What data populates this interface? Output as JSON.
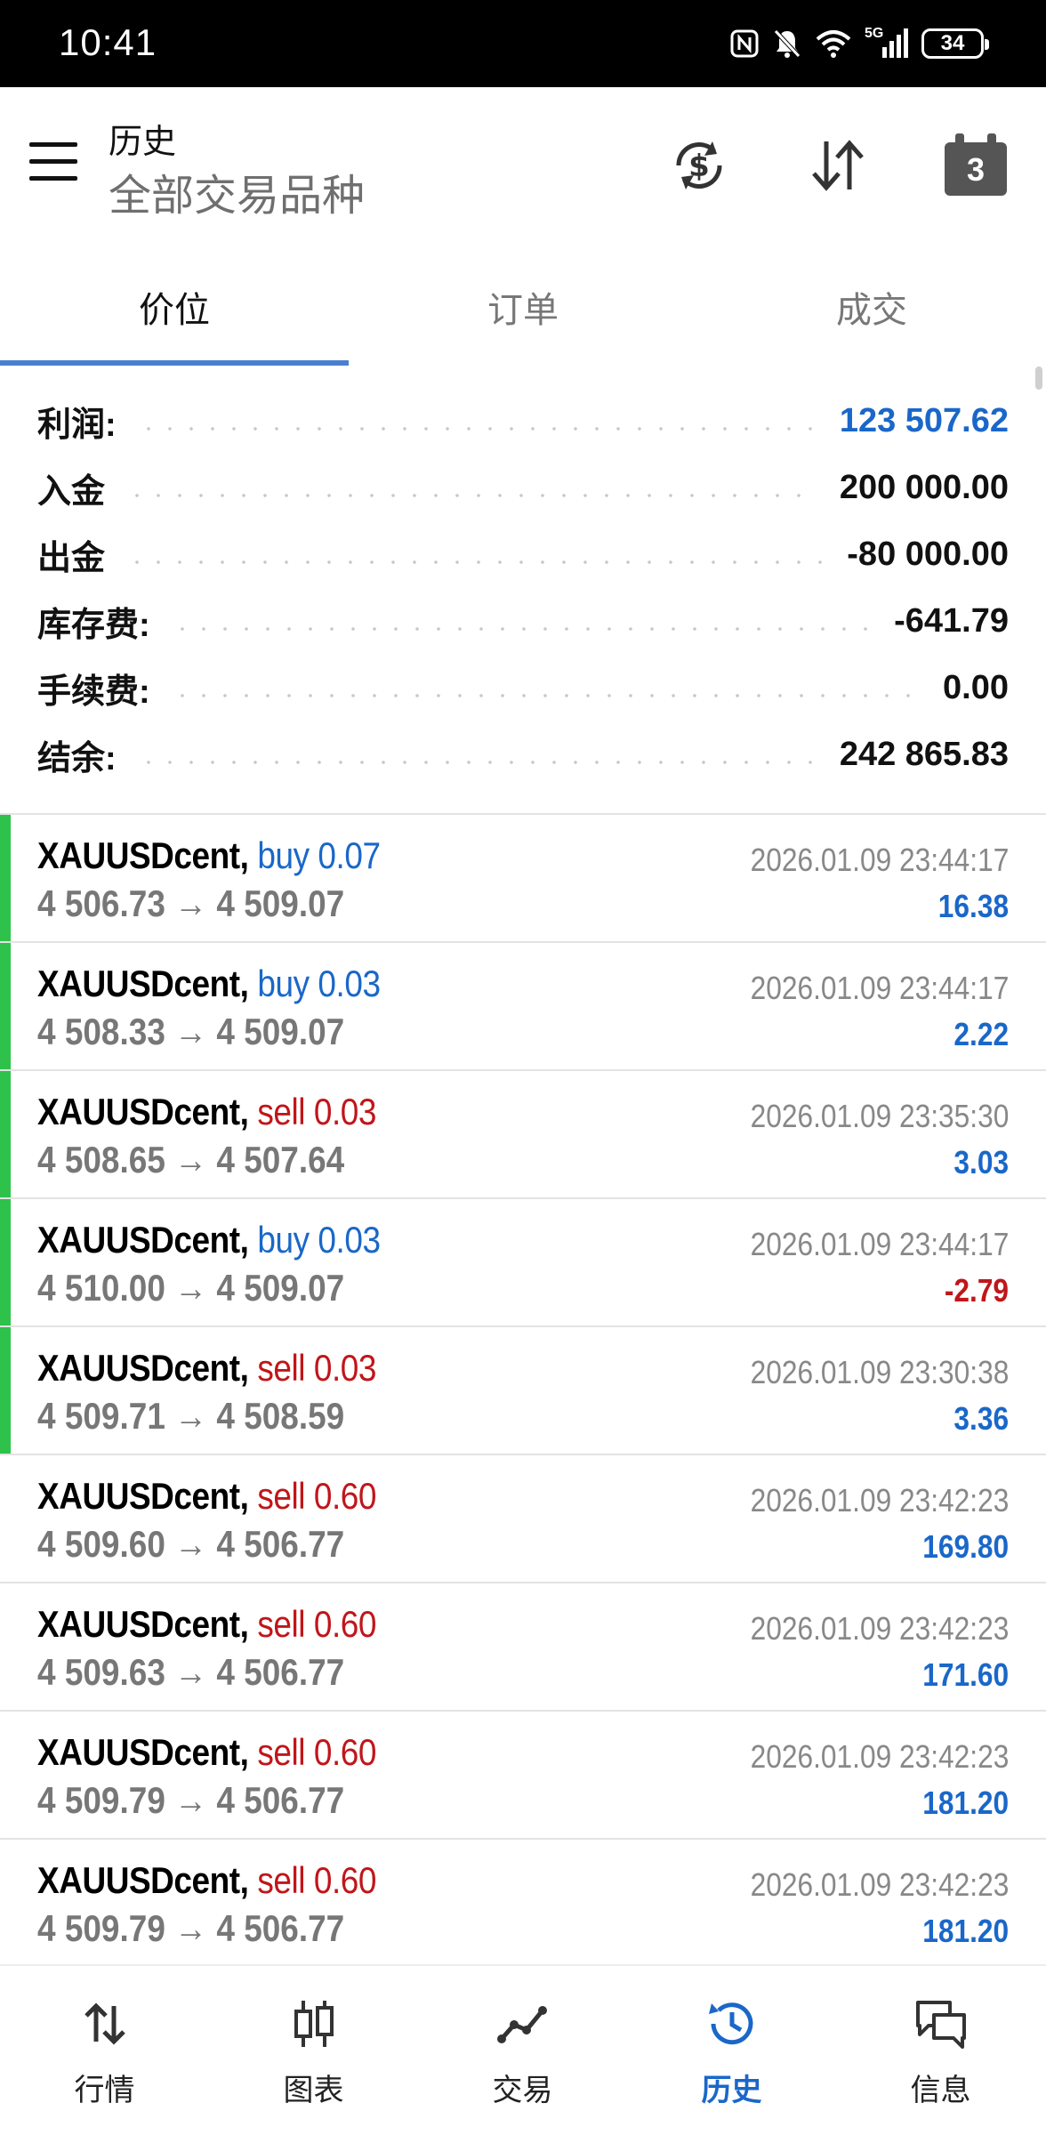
{
  "status_bar": {
    "time": "10:41",
    "network": "5G",
    "battery": "34"
  },
  "header": {
    "title": "历史",
    "subtitle": "全部交易品种"
  },
  "tabs": [
    {
      "label": "价位",
      "active": true
    },
    {
      "label": "订单",
      "active": false
    },
    {
      "label": "成交",
      "active": false
    }
  ],
  "summary": [
    {
      "label": "利润:",
      "value": "123 507.62",
      "highlight": true
    },
    {
      "label": "入金",
      "value": "200 000.00",
      "highlight": false
    },
    {
      "label": "出金",
      "value": "-80 000.00",
      "highlight": false
    },
    {
      "label": "库存费:",
      "value": "-641.79",
      "highlight": false
    },
    {
      "label": "手续费:",
      "value": "0.00",
      "highlight": false
    },
    {
      "label": "结余:",
      "value": "242 865.83",
      "highlight": false
    }
  ],
  "deals": [
    {
      "symbol": "XAUUSDcent,",
      "side": "buy 0.07",
      "type": "buy",
      "prices": "4 506.73 → 4 509.07",
      "time": "2026.01.09 23:44:17",
      "profit": "16.38",
      "profit_sign": "pos",
      "marked": true
    },
    {
      "symbol": "XAUUSDcent,",
      "side": "buy 0.03",
      "type": "buy",
      "prices": "4 508.33 → 4 509.07",
      "time": "2026.01.09 23:44:17",
      "profit": "2.22",
      "profit_sign": "pos",
      "marked": true
    },
    {
      "symbol": "XAUUSDcent,",
      "side": "sell 0.03",
      "type": "sell",
      "prices": "4 508.65 → 4 507.64",
      "time": "2026.01.09 23:35:30",
      "profit": "3.03",
      "profit_sign": "pos",
      "marked": true
    },
    {
      "symbol": "XAUUSDcent,",
      "side": "buy 0.03",
      "type": "buy",
      "prices": "4 510.00 → 4 509.07",
      "time": "2026.01.09 23:44:17",
      "profit": "-2.79",
      "profit_sign": "neg",
      "marked": true
    },
    {
      "symbol": "XAUUSDcent,",
      "side": "sell 0.03",
      "type": "sell",
      "prices": "4 509.71 → 4 508.59",
      "time": "2026.01.09 23:30:38",
      "profit": "3.36",
      "profit_sign": "pos",
      "marked": true
    },
    {
      "symbol": "XAUUSDcent,",
      "side": "sell 0.60",
      "type": "sell",
      "prices": "4 509.60 → 4 506.77",
      "time": "2026.01.09 23:42:23",
      "profit": "169.80",
      "profit_sign": "pos",
      "marked": false
    },
    {
      "symbol": "XAUUSDcent,",
      "side": "sell 0.60",
      "type": "sell",
      "prices": "4 509.63 → 4 506.77",
      "time": "2026.01.09 23:42:23",
      "profit": "171.60",
      "profit_sign": "pos",
      "marked": false
    },
    {
      "symbol": "XAUUSDcent,",
      "side": "sell 0.60",
      "type": "sell",
      "prices": "4 509.79 → 4 506.77",
      "time": "2026.01.09 23:42:23",
      "profit": "181.20",
      "profit_sign": "pos",
      "marked": false
    },
    {
      "symbol": "XAUUSDcent,",
      "side": "sell 0.60",
      "type": "sell",
      "prices": "4 509.79 → 4 506.77",
      "time": "2026.01.09 23:42:23",
      "profit": "181.20",
      "profit_sign": "pos",
      "marked": false
    }
  ],
  "calendar": {
    "day": "3"
  },
  "bottom_nav": [
    {
      "label": "行情",
      "icon": "quotes-icon",
      "active": false
    },
    {
      "label": "图表",
      "icon": "chart-icon",
      "active": false
    },
    {
      "label": "交易",
      "icon": "trade-icon",
      "active": false
    },
    {
      "label": "历史",
      "icon": "history-icon",
      "active": true
    },
    {
      "label": "信息",
      "icon": "messages-icon",
      "active": false
    }
  ],
  "colors": {
    "accent": "#1a67c9",
    "sell": "#c0161a",
    "marker": "#2ec24a",
    "tab_underline": "#4a7fd0"
  }
}
